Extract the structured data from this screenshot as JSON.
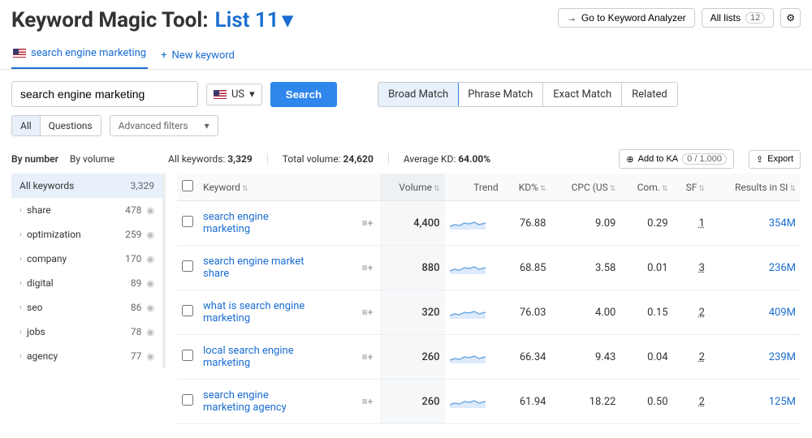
{
  "header": {
    "title_prefix": "Keyword Magic Tool:",
    "list_name": "List 11",
    "go_to_analyzer": "Go to Keyword Analyzer",
    "all_lists_label": "All lists",
    "all_lists_count": "12"
  },
  "tabs": {
    "active_tab": "search engine marketing",
    "new_keyword": "New keyword"
  },
  "search": {
    "value": "search engine marketing",
    "country": "US",
    "button": "Search",
    "matches": [
      "Broad Match",
      "Phrase Match",
      "Exact Match",
      "Related"
    ],
    "active_match": 0
  },
  "filters": {
    "toggle": [
      "All",
      "Questions"
    ],
    "active_toggle": 0,
    "advanced": "Advanced filters"
  },
  "sort": {
    "by_number": "By number",
    "by_volume": "By volume"
  },
  "summary": {
    "all_label": "All keywords:",
    "all_value": "3,329",
    "total_label": "Total volume:",
    "total_value": "24,620",
    "avg_label": "Average KD:",
    "avg_value": "64.00%",
    "add_to_ka": "Add to KA",
    "ka_count": "0 / 1,000",
    "export": "Export"
  },
  "sidebar": [
    {
      "label": "All keywords",
      "count": "3,329",
      "selected": true
    },
    {
      "label": "share",
      "count": "478"
    },
    {
      "label": "optimization",
      "count": "259"
    },
    {
      "label": "company",
      "count": "170"
    },
    {
      "label": "digital",
      "count": "89"
    },
    {
      "label": "seo",
      "count": "86"
    },
    {
      "label": "jobs",
      "count": "78"
    },
    {
      "label": "agency",
      "count": "77"
    }
  ],
  "table": {
    "columns": {
      "keyword": "Keyword",
      "volume": "Volume",
      "trend": "Trend",
      "kd": "KD%",
      "cpc": "CPC (US",
      "com": "Com.",
      "sf": "SF",
      "results": "Results in SI"
    },
    "rows": [
      {
        "kw": "search engine marketing",
        "vol": "4,400",
        "kd": "76.88",
        "cpc": "9.09",
        "com": "0.29",
        "sf": "1",
        "res": "354M"
      },
      {
        "kw": "search engine market share",
        "vol": "880",
        "kd": "68.85",
        "cpc": "3.58",
        "com": "0.01",
        "sf": "3",
        "res": "236M"
      },
      {
        "kw": "what is search engine marketing",
        "vol": "320",
        "kd": "76.03",
        "cpc": "4.00",
        "com": "0.15",
        "sf": "2",
        "res": "409M"
      },
      {
        "kw": "local search engine marketing",
        "vol": "260",
        "kd": "66.34",
        "cpc": "9.43",
        "com": "0.04",
        "sf": "2",
        "res": "239M"
      },
      {
        "kw": "search engine marketing agency",
        "vol": "260",
        "kd": "61.94",
        "cpc": "18.22",
        "com": "0.50",
        "sf": "2",
        "res": "125M"
      }
    ]
  }
}
